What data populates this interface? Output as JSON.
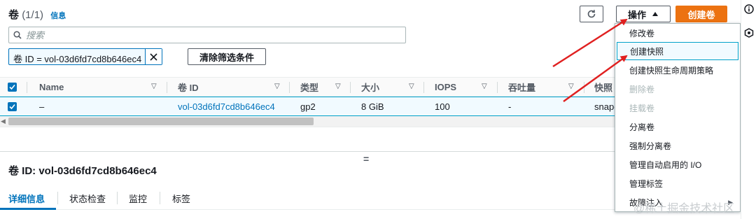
{
  "header": {
    "title": "卷",
    "count": "(1/1)",
    "info_link": "信息"
  },
  "search": {
    "placeholder": "搜索"
  },
  "filter": {
    "token_label": "卷 ID = vol-03d6fd7cd8b646ec4",
    "clear_label": "清除筛选条件"
  },
  "toolbar": {
    "actions_label": "操作",
    "create_label": "创建卷"
  },
  "table": {
    "columns": [
      "Name",
      "卷 ID",
      "类型",
      "大小",
      "IOPS",
      "吞吐量",
      "快照"
    ],
    "row": {
      "name": "–",
      "volume_id": "vol-03d6fd7cd8b646ec4",
      "type": "gp2",
      "size": "8 GiB",
      "iops": "100",
      "throughput": "-",
      "snapshot": "snap-"
    }
  },
  "resize_handle": "=",
  "details": {
    "title": "卷 ID: vol-03d6fd7cd8b646ec4",
    "tabs": [
      "详细信息",
      "状态检查",
      "监控",
      "标签"
    ]
  },
  "menu": {
    "items": [
      {
        "label": "修改卷",
        "state": "enabled"
      },
      {
        "label": "创建快照",
        "state": "highlighted"
      },
      {
        "label": "创建快照生命周期策略",
        "state": "enabled"
      },
      {
        "label": "删除卷",
        "state": "disabled"
      },
      {
        "label": "挂载卷",
        "state": "disabled"
      },
      {
        "label": "分离卷",
        "state": "enabled"
      },
      {
        "label": "强制分离卷",
        "state": "enabled"
      },
      {
        "label": "管理自动启用的 I/O",
        "state": "enabled"
      },
      {
        "label": "管理标签",
        "state": "enabled"
      },
      {
        "label": "故障注入",
        "state": "enabled",
        "submenu": true
      }
    ]
  },
  "watermark": "@稀土掘金技术社区",
  "colors": {
    "primary_button": "#ec7211",
    "link": "#0073bb",
    "annotation_arrow": "#e02020"
  }
}
